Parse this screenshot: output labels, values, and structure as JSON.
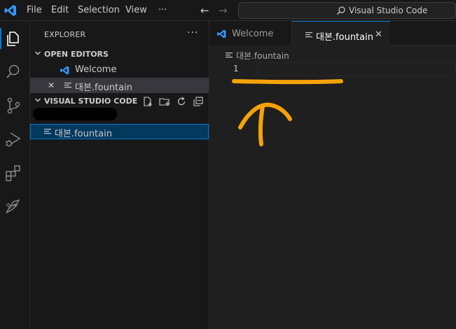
{
  "titlebar": {
    "menu": [
      "File",
      "Edit",
      "Selection",
      "View",
      "···"
    ],
    "command_center": "Visual Studio Code"
  },
  "activity_bar": {
    "icons": [
      "explorer-icon",
      "search-icon",
      "source-control-icon",
      "run-debug-icon",
      "extensions-icon",
      "fountain-extension-icon"
    ]
  },
  "sidebar": {
    "title": "EXPLORER",
    "more": "···",
    "open_editors": {
      "label": "OPEN EDITORS",
      "items": [
        {
          "name": "Welcome",
          "icon": "vscode-icon"
        },
        {
          "name": "대본.fountain",
          "icon": "text-lines-icon",
          "close": "✕"
        }
      ]
    },
    "workspace": {
      "label": "VISUAL STUDIO CODE",
      "actions": [
        "new-file-icon",
        "new-folder-icon",
        "refresh-icon",
        "collapse-all-icon"
      ],
      "files": [
        {
          "name": "대본.fountain",
          "icon": "text-lines-icon"
        }
      ]
    }
  },
  "editor": {
    "tabs": [
      {
        "label": "Welcome",
        "active": false,
        "icon": "vscode-icon"
      },
      {
        "label": "대본.fountain",
        "active": true,
        "icon": "text-lines-icon",
        "close": "✕"
      }
    ],
    "breadcrumb": "대본.fountain",
    "line_numbers": [
      "1"
    ]
  },
  "colors": {
    "accent": "#0078d4",
    "vscode_blue": "#3794ff",
    "annotation": "#f5a20a"
  }
}
